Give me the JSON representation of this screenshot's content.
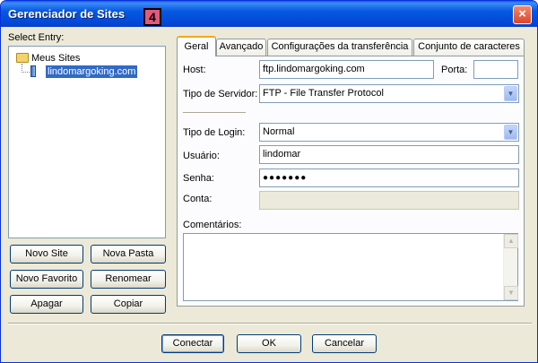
{
  "window": {
    "title": "Gerenciador de Sites",
    "step_badge": "4",
    "close_glyph": "×"
  },
  "sidebar": {
    "select_entry_label": "Select Entry:",
    "tree": {
      "root_label": "Meus Sites",
      "root_icon": "folder-icon",
      "site_label": "lindomargoking.com",
      "site_icon": "server-icon"
    },
    "buttons": {
      "novo_site": "Novo Site",
      "nova_pasta": "Nova Pasta",
      "novo_favorito": "Novo Favorito",
      "renomear": "Renomear",
      "apagar": "Apagar",
      "copiar": "Copiar"
    }
  },
  "tabs": [
    "Geral",
    "Avançado",
    "Configurações da transferência",
    "Conjunto de caracteres"
  ],
  "form": {
    "host_label": "Host:",
    "host_value": "ftp.lindomargoking.com",
    "porta_label": "Porta:",
    "porta_value": "",
    "tipo_servidor_label": "Tipo de Servidor:",
    "tipo_servidor_value": "FTP - File Transfer Protocol",
    "tipo_login_label": "Tipo de Login:",
    "tipo_login_value": "Normal",
    "usuario_label": "Usuário:",
    "usuario_value": "lindomar",
    "senha_label": "Senha:",
    "senha_value": "●●●●●●●",
    "conta_label": "Conta:",
    "conta_value": "",
    "comentarios_label": "Comentários:",
    "comentarios_value": ""
  },
  "footer": {
    "conectar": "Conectar",
    "ok": "OK",
    "cancelar": "Cancelar"
  },
  "colors": {
    "titlebar": "#0558e1",
    "selection": "#316ac5",
    "active_tab_accent": "#f5a622",
    "badge": "#e05a7e",
    "window_bg": "#ece9d8"
  }
}
